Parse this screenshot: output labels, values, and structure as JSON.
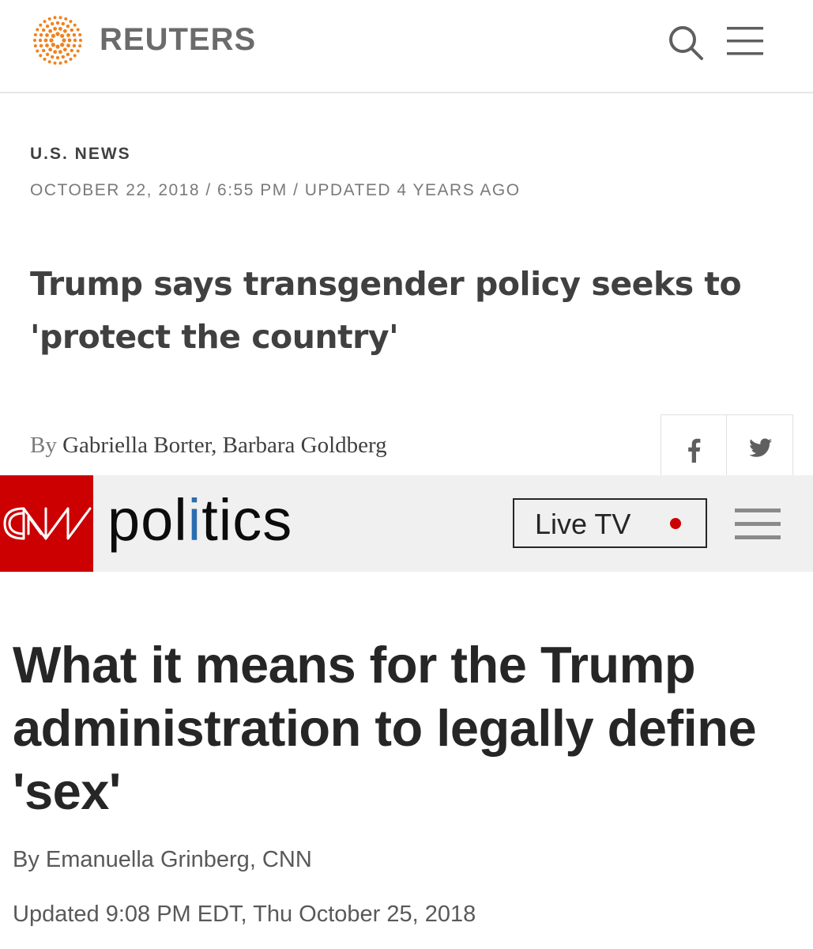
{
  "reuters": {
    "brand": "REUTERS",
    "colors": {
      "logo": "#f0821e",
      "text": "#404040",
      "muted": "#7a7a7a"
    },
    "icons": {
      "logo": "reuters-dot-logo-icon",
      "search": "search-icon",
      "menu": "hamburger-menu-icon",
      "facebook": "facebook-icon",
      "twitter": "twitter-icon"
    },
    "section": "U.S. NEWS",
    "dateline": "OCTOBER 22, 2018 / 6:55 PM / UPDATED 4 YEARS AGO",
    "headline": "Trump says transgender policy seeks to 'protect the country'",
    "byline_prefix": "By",
    "byline_authors": "Gabriella Borter, Barbara Goldberg"
  },
  "cnn": {
    "brand": "CNN",
    "section_label": "politics",
    "colors": {
      "brand_red": "#cc0000",
      "i_accent": "#2b6cb0",
      "header_bg": "#f0f0f0"
    },
    "icons": {
      "logo": "cnn-logo-icon",
      "menu": "hamburger-menu-icon",
      "live": "live-dot-icon"
    },
    "live_tv": "Live TV",
    "headline": "What it means for the Trump administration to legally define 'sex'",
    "byline": "By Emanuella Grinberg, CNN",
    "updated": "Updated 9:08 PM EDT, Thu October 25, 2018"
  }
}
